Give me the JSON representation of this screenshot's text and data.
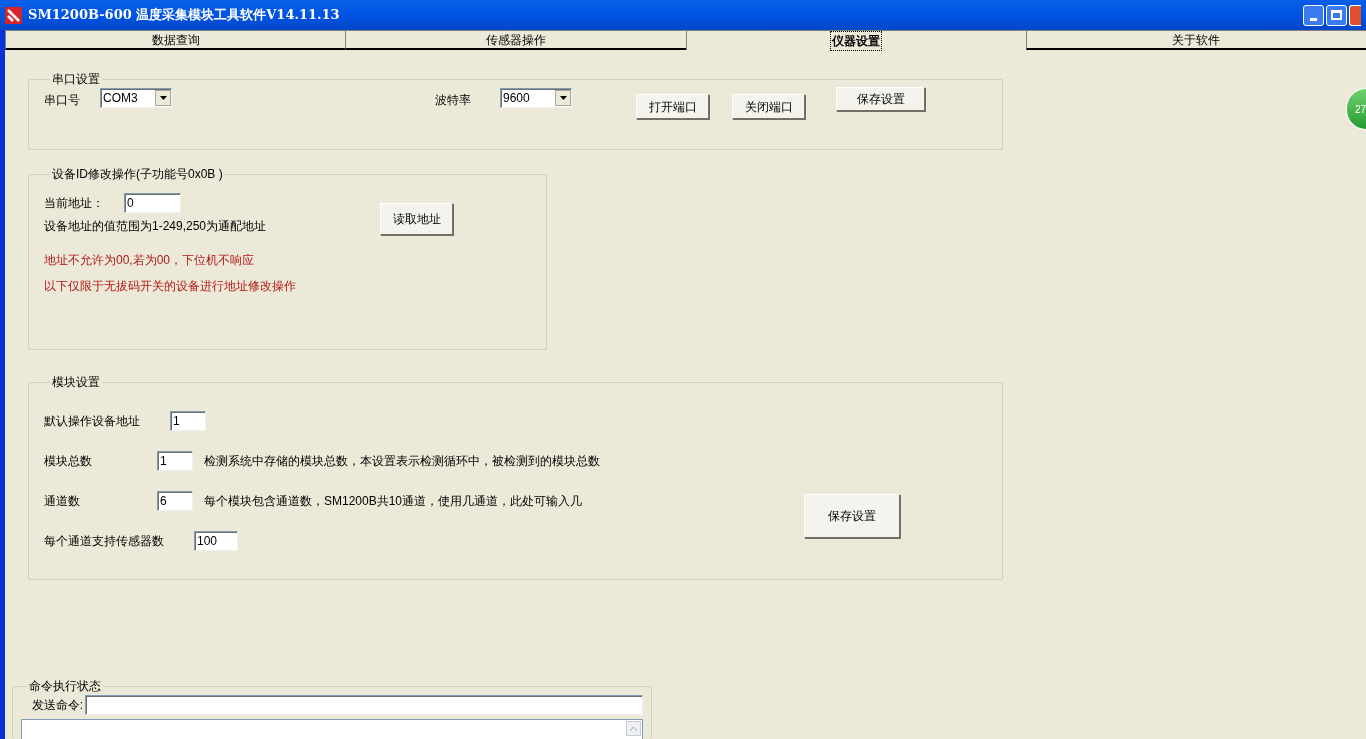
{
  "window": {
    "title": "SM1200B-600 温度采集模块工具软件V14.11.13"
  },
  "tabs": [
    {
      "label": "数据查询",
      "selected": false
    },
    {
      "label": "传感器操作",
      "selected": false
    },
    {
      "label": "仪器设置",
      "selected": true
    },
    {
      "label": "关于软件",
      "selected": false
    }
  ],
  "serial_group": {
    "title": "串口设置",
    "port_label": "串口号",
    "port_value": "COM3",
    "baud_label": "波特率",
    "baud_value": "9600",
    "buttons": [
      "打开端口",
      "关闭端口",
      "保存设置"
    ]
  },
  "device_id_group": {
    "title": "设备ID修改操作(子功能号0x0B )",
    "address_label": "当前地址：",
    "address_value": "0",
    "range_note": "设备地址的值范围为1-249,250为通配地址",
    "read_button": "读取地址",
    "warnings": [
      "地址不允许为00,若为00，下位机不响应",
      "以下仅限于无拔码开关的设备进行地址修改操作"
    ]
  },
  "module_group": {
    "title": "模块设置",
    "rows": [
      {
        "label": "默认操作设备地址",
        "value": "1"
      },
      {
        "label": "模块总数",
        "value": "1",
        "note": "检测系统中存储的模块总数，本设置表示检测循环中，被检测到的模块总数"
      },
      {
        "label": "通道数",
        "value": "6",
        "note": "每个模块包含通道数，SM1200B共10通道，使用几通道，此处可输入几"
      },
      {
        "label": "每个通道支持传感器数",
        "value": "100"
      }
    ],
    "save_button": "保存设置"
  },
  "status_group": {
    "title": "命令执行状态",
    "send_label": "发送命令:"
  },
  "floating_badge": {
    "text": "27"
  }
}
